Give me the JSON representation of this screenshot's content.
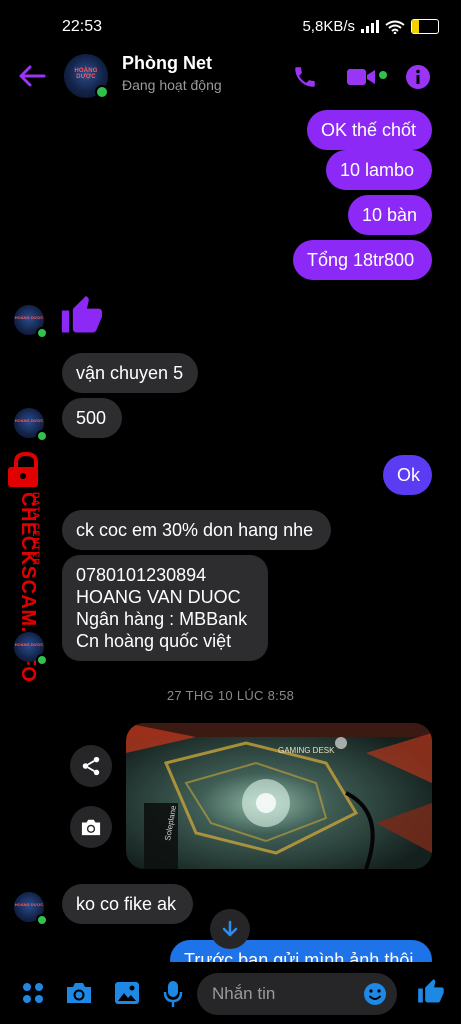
{
  "status_bar": {
    "time": "22:53",
    "network_speed": "5,8KB/s",
    "battery": "28",
    "battery_level": 0.28
  },
  "header": {
    "contact_name": "Phòng Net",
    "status": "Đang hoạt động",
    "avatar_text": "HOÀNG DƯỢC",
    "icons": [
      "back-arrow-icon",
      "phone-icon",
      "video-camera-icon",
      "info-icon"
    ]
  },
  "messages": {
    "out_1": "OK thế chốt",
    "out_2": "10 lambo",
    "out_3": "10 bàn",
    "out_4": "Tổng 18tr800",
    "in_1": "vận chuyen 5",
    "in_2": "500",
    "out_5": "Ok",
    "in_3": "ck coc em 30% don hang nhe",
    "in_4": "0780101230894\nHOANG VAN DUOC\nNgân hàng : MBBank\nCn hoàng quốc việt",
    "in_5": "ko co fike ak",
    "out_6": "Trước bạn gửi mình ảnh thôi"
  },
  "timestamp": "27 THG 10 LÚC 8:58",
  "photo": {
    "caption_text": "GAMING DESK",
    "brand_text": "Soleplane"
  },
  "watermark": {
    "small": "DATA CENTER",
    "big": "CHECKSCAM.INFO"
  },
  "composer": {
    "placeholder": "Nhắn tin",
    "icons": [
      "apps-icon",
      "camera-icon",
      "gallery-icon",
      "microphone-icon",
      "emoji-icon",
      "thumbs-up-icon"
    ]
  },
  "colors": {
    "accent": "#8c29f6",
    "icon_blue": "#1e88e5",
    "header_purple": "#9b35f5",
    "watermark_red": "#e00000"
  }
}
